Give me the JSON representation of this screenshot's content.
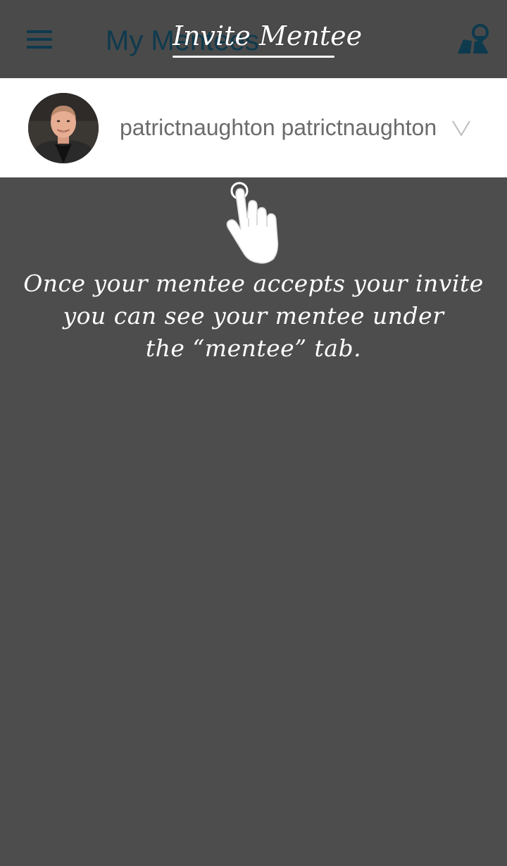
{
  "header": {
    "screen_title": "My Mentees",
    "overlay_title": "Invite Mentee",
    "menu_icon": "hamburger-menu-icon",
    "map_icon": "map-pin-icon",
    "accent_color": "#0e3a4e"
  },
  "profile": {
    "name": "patrictnaughton patrictnaughton",
    "avatar_icon": "avatar",
    "dropdown_icon": "chevron-down-icon"
  },
  "coach_overlay": {
    "hand_icon": "tap-hand-icon",
    "hint_lines": [
      "Once your mentee accepts your invite",
      "you can see your mentee under",
      "the “mentee” tab."
    ]
  }
}
